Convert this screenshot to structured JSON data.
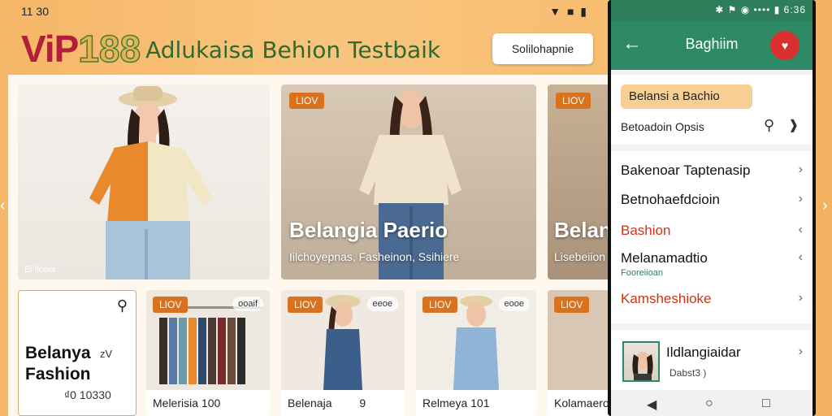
{
  "status": {
    "time": "11 30",
    "icons": "▼ ■ ▮"
  },
  "brand": {
    "logo": "ViP",
    "logo_num": "188",
    "tagline": "Adlukaisa Behion Testbaik"
  },
  "top_button": {
    "label": "Solilohapnie"
  },
  "hero_cards": [
    {
      "caption": "Ei llcoia"
    },
    {
      "badge": "LIOV",
      "title": "Belangia Paerio",
      "subtitle": "Iilchoyepnas, Fasheinon, Ssihiere"
    },
    {
      "badge": "LIOV",
      "title": "Belan",
      "subtitle": "Lisebeiion"
    }
  ],
  "feature_card": {
    "title": "Belanya Fashion",
    "aside": "zV",
    "price": "₫0 10330"
  },
  "small_cards": [
    {
      "badge": "LIOV",
      "pill": "ooaif",
      "caption": "Melerisia 100"
    },
    {
      "badge": "LIOV",
      "pill": "eeoe",
      "caption": "Belenaja",
      "aside": "9"
    },
    {
      "badge": "LIOV",
      "pill": "eooe",
      "caption": "Relmeya 101"
    },
    {
      "badge": "LIOV",
      "pill": "",
      "caption": "Kolamaero"
    }
  ],
  "phone": {
    "status_time": "6:36",
    "status_icons": "✱ ⚑ ◉ •••• ▮",
    "title": "Baghiim",
    "chip": "Belansi a Bachio",
    "search_text": "Betoadoin Opsis",
    "items": [
      {
        "label": "Bakenoar Taptenasip",
        "sub": ""
      },
      {
        "label": "Betnohaefdcioin",
        "sub": ""
      },
      {
        "label": "Bashion",
        "sub": ""
      },
      {
        "label": "Melanamadtio",
        "sub": "Fooreiioan"
      },
      {
        "label": "Kamsheshioke",
        "sub": ""
      }
    ],
    "user": {
      "name": "Ildlangiaidar",
      "meta": "Dabst3 )"
    }
  },
  "colors": {
    "accent": "#2e8a64",
    "brand_red": "#b0203a",
    "badge": "#d8721f",
    "highlight_red": "#c7361a"
  }
}
